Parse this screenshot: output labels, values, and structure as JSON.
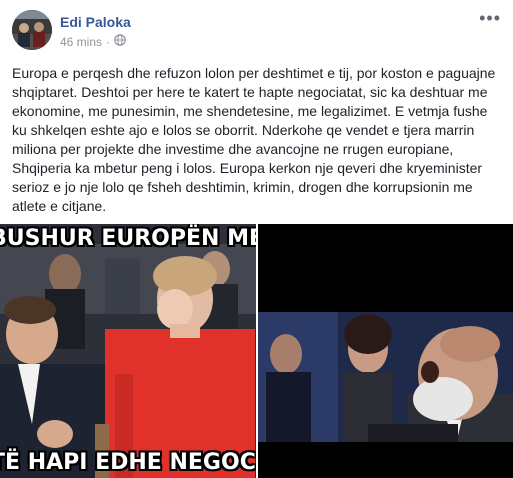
{
  "post": {
    "author": "Edi Paloka",
    "time": "46 mins",
    "separator": "·",
    "privacy_icon": "globe-icon",
    "more_icon": "ellipsis-icon",
    "more_glyph": "•••",
    "text": "Europa e perqesh dhe refuzon lolon per deshtimet e tij, por koston e paguajne shqiptaret. Deshtoi per here te katert te hapte negociatat, sic ka deshtuar me ekonomine, me punesimin, me shendetesine, me legalizimet. E vetmja fushe ku shkelqen eshte ajo e lolos se oborrit. Nderkohe qe vendet e tjera marrin miliona per projekte dhe investime dhe avancojne ne rrugen europiane, Shqiperia ka mbetur peng i lolos. Europa kerkon nje qeveri dhe kryeminister serioz e jo nje lolo qe fsheh deshtimin, krimin, drogen dhe korrupsionin me atlete e citjane."
  },
  "photos": {
    "left": {
      "caption_top": "BUSHUR EUROPËN ME I",
      "caption_bottom": "TË HAPI EDHE NEGOCIA"
    }
  },
  "colors": {
    "author_link": "#365899",
    "meta_text": "#90949c",
    "jacket_red": "#e0322a"
  }
}
